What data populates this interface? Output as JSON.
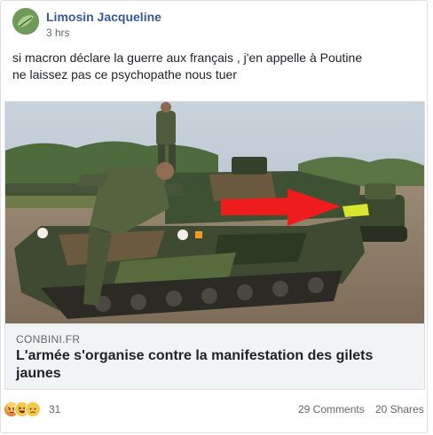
{
  "post": {
    "author": "Limosin Jacqueline",
    "time": "3 hrs",
    "message_lines": [
      "si macron déclare la guerre aux français , j'en appelle à Poutine",
      "ne laissez pas ce psychopathe nous tuer"
    ]
  },
  "link": {
    "domain": "CONBINI.FR",
    "headline": "L'armée s'organise contre la manifestation des gilets jaunes",
    "image_icon": "tank-photo",
    "annotation_color": "#ee1c1c"
  },
  "footer": {
    "reaction_icons": [
      "angry-icon",
      "haha-icon",
      "sad-icon"
    ],
    "reaction_count": "31",
    "comments": "29 Comments",
    "shares": "20 Shares"
  },
  "colors": {
    "author": "#385898",
    "meta": "#606770",
    "card_bg": "#f2f3f5"
  }
}
